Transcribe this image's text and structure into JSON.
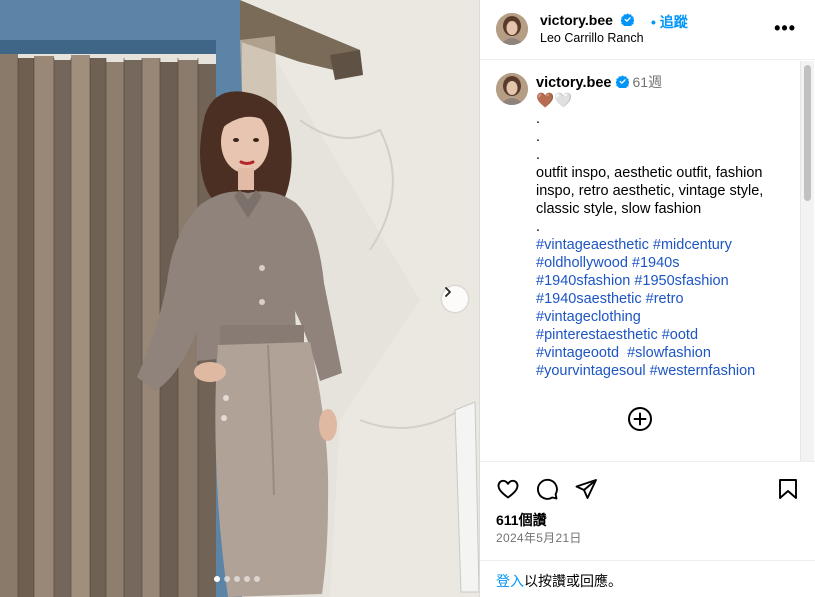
{
  "colors": {
    "link": "#0095f6",
    "hashtag": "#1d55c4",
    "verified": "#0095f6",
    "secondary_text": "#737373"
  },
  "photo": {
    "next_icon": "chevron-right-icon",
    "carousel_dots": 5,
    "active_dot": 1
  },
  "header": {
    "username": "victory.bee",
    "follow_label": "追蹤",
    "location": "Leo Carrillo Ranch",
    "more_icon": "more-horizontal-icon",
    "more_label": "•••"
  },
  "caption": {
    "username": "victory.bee",
    "time": "61週",
    "emojis": "🤎🤍",
    "lines": [
      ".",
      ".",
      ".",
      "outfit inspo, aesthetic outfit, fashion inspo, retro aesthetic, vintage style, classic style, slow fashion",
      "."
    ],
    "hashtag_lines": [
      "#vintageaesthetic #midcentury",
      "#oldhollywood #1940s",
      "#1940sfashion #1950sfashion",
      "#1940saesthetic #retro",
      "#vintageclothing",
      "#pinterestaesthetic #ootd",
      "#vintageootd  #slowfashion",
      "#yourvintagesoul #westernfashion"
    ],
    "load_more_icon": "plus-circle-icon"
  },
  "actions": {
    "like_icon": "heart-icon",
    "comment_icon": "comment-icon",
    "share_icon": "send-icon",
    "save_icon": "bookmark-icon"
  },
  "stats": {
    "likes": "611個讚",
    "date": "2024年5月21日"
  },
  "login_prompt": {
    "link": "登入",
    "rest": "以按讚或回應。"
  }
}
